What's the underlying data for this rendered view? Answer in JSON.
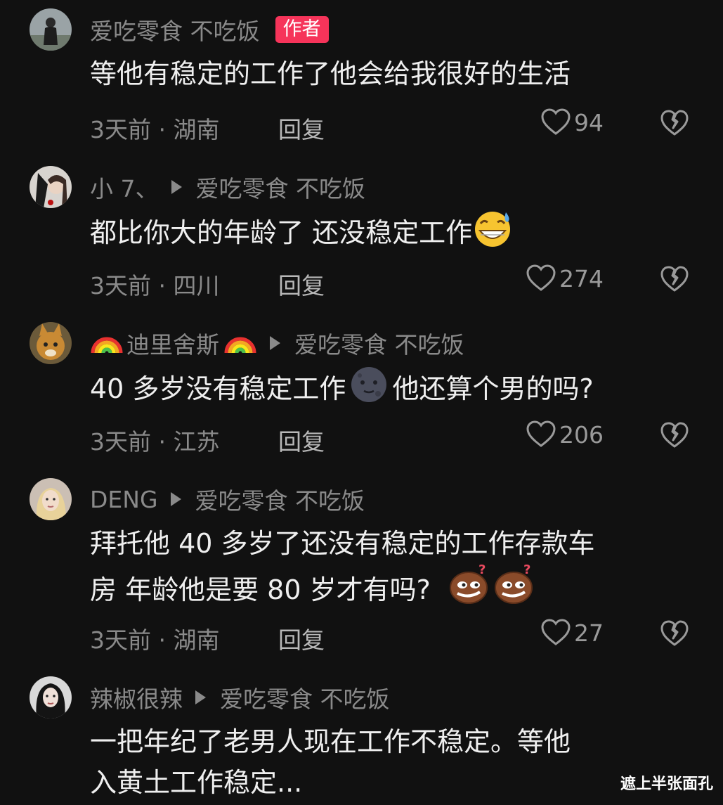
{
  "comments": [
    {
      "username": "爱吃零食 不吃饭",
      "badge": "作者",
      "text": "等他有稳定的工作了他会给我很好的生活",
      "time_location": "3天前 · 湖南",
      "reply_label": "回复",
      "likes": "94"
    },
    {
      "username": "小 7、",
      "reply_to": "爱吃零食 不吃饭",
      "text": "都比你大的年龄了 还没稳定工作",
      "time_location": "3天前 · 四川",
      "reply_label": "回复",
      "likes": "274"
    },
    {
      "username": "迪里舍斯",
      "reply_to": "爱吃零食 不吃饭",
      "text_a": "40 多岁没有稳定工作",
      "text_b": "他还算个男的吗?",
      "time_location": "3天前 · 江苏",
      "reply_label": "回复",
      "likes": "206"
    },
    {
      "username": "DENG",
      "reply_to": "爱吃零食 不吃饭",
      "text_line1": "拜托他 40 多岁了还没有稳定的工作存款车",
      "text_line2": "房  年龄他是要 80 岁才有吗?",
      "time_location": "3天前 · 湖南",
      "reply_label": "回复",
      "likes": "27"
    },
    {
      "username": "辣椒很辣",
      "reply_to": "爱吃零食 不吃饭",
      "text_line1": "一把年纪了老男人现在工作不稳定。等他",
      "text_line2": "入黄土工作稳定..."
    }
  ],
  "watermark": "遮上半张面孔",
  "colors": {
    "background": "#111111",
    "author_badge": "#f6345a",
    "meta_text": "#8a8a8a",
    "comment_text": "#efefef"
  },
  "icons": [
    "heart-icon",
    "broken-heart-icon",
    "reply-arrow-icon",
    "rainbow-emoji",
    "sweat-grin-emoji",
    "new-moon-face-emoji",
    "smirk-question-emoji"
  ]
}
